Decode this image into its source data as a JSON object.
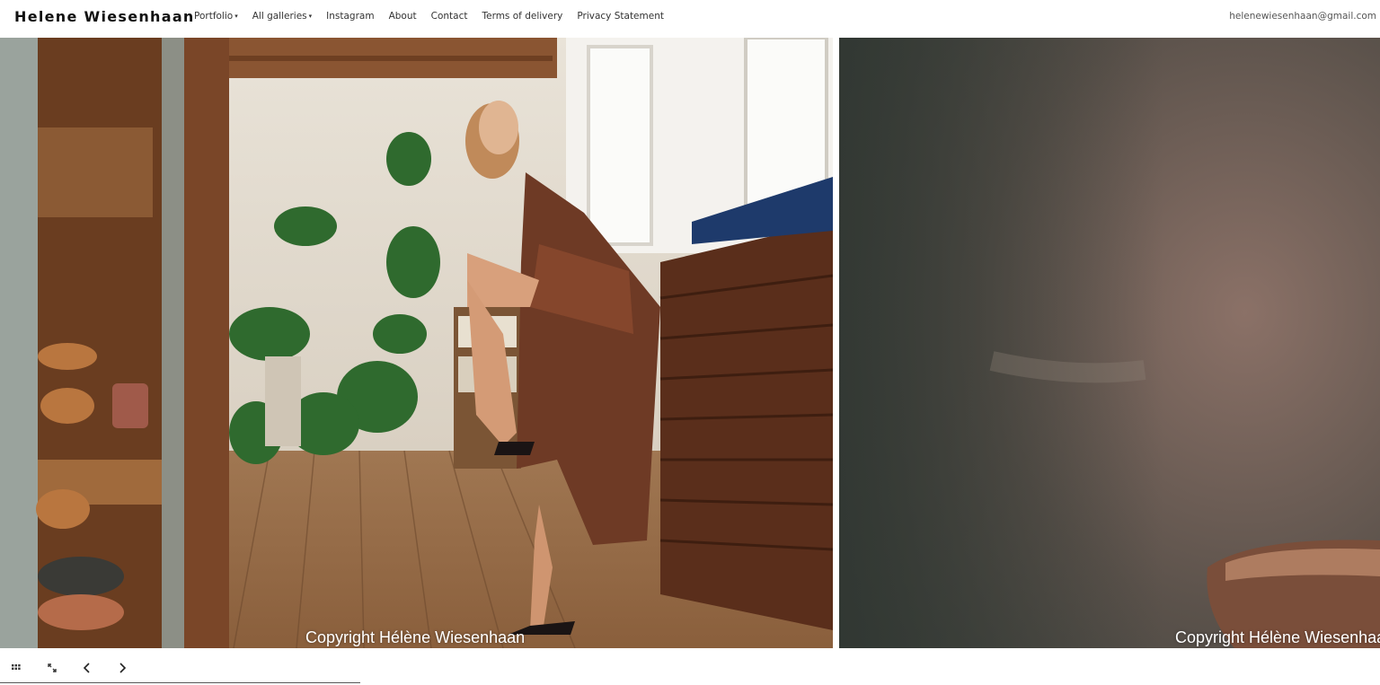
{
  "header": {
    "brand": "Helene Wiesenhaan",
    "nav": [
      {
        "label": "Portfolio",
        "dropdown": true
      },
      {
        "label": "All galleries",
        "dropdown": true
      },
      {
        "label": "Instagram",
        "dropdown": false
      },
      {
        "label": "About",
        "dropdown": false
      },
      {
        "label": "Contact",
        "dropdown": false
      },
      {
        "label": "Terms of delivery",
        "dropdown": false
      },
      {
        "label": "Privacy Statement",
        "dropdown": false
      }
    ],
    "email": "helenewiesenhaan@gmail.com"
  },
  "gallery": {
    "slides": [
      {
        "caption": "Copyright Hélène Wiesenhaan"
      },
      {
        "caption": "Copyright Hélène Wiesenhaan"
      }
    ]
  },
  "controls": {
    "icons": [
      "grid-icon",
      "fullscreen-icon",
      "chevron-left-icon",
      "chevron-right-icon"
    ]
  },
  "colors": {
    "text": "#333333",
    "brand": "#111111",
    "background": "#ffffff"
  }
}
